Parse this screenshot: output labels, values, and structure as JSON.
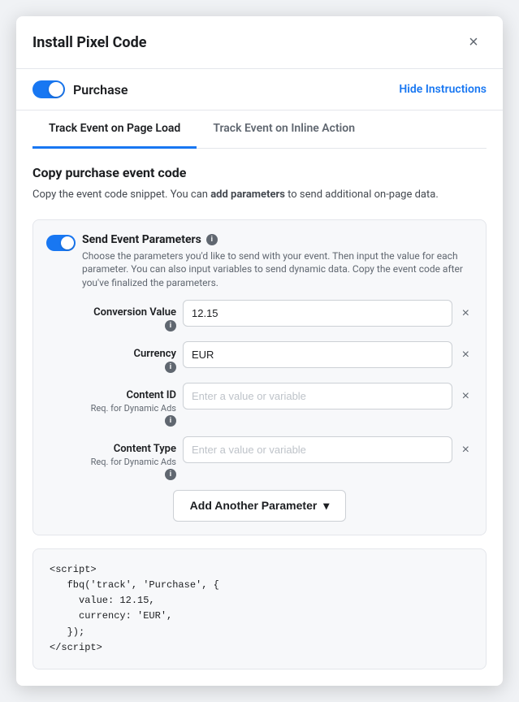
{
  "modal": {
    "title": "Install Pixel Code",
    "close_label": "×"
  },
  "header": {
    "toggle_label": "Purchase",
    "hide_instructions_label": "Hide Instructions"
  },
  "tabs": [
    {
      "label": "Track Event on Page Load",
      "active": true
    },
    {
      "label": "Track Event on Inline Action",
      "active": false
    }
  ],
  "section": {
    "title": "Copy purchase event code",
    "desc_plain": "Copy the event code snippet. You can ",
    "desc_bold": "add parameters",
    "desc_end": " to send additional on-page data."
  },
  "params": {
    "toggle_on": true,
    "title": "Send Event Parameters",
    "subtitle": "Choose the parameters you'd like to send with your event. Then input the value for each parameter. You can also input variables to send dynamic data. Copy the event code after you've finalized the parameters.",
    "rows": [
      {
        "label": "Conversion Value",
        "sublabel": "",
        "has_info": true,
        "value": "12.15",
        "placeholder": ""
      },
      {
        "label": "Currency",
        "sublabel": "",
        "has_info": true,
        "value": "EUR",
        "placeholder": ""
      },
      {
        "label": "Content ID",
        "sublabel": "Req. for Dynamic Ads",
        "has_info": true,
        "value": "",
        "placeholder": "Enter a value or variable"
      },
      {
        "label": "Content Type",
        "sublabel": "Req. for Dynamic Ads",
        "has_info": true,
        "value": "",
        "placeholder": "Enter a value or variable"
      }
    ],
    "add_button": "Add Another Parameter"
  },
  "code": {
    "content": "<script>\n   fbq('track', 'Purchase', {\n     value: 12.15,\n     currency: 'EUR',\n   });\n</script>"
  },
  "icons": {
    "info": "i",
    "close": "×",
    "dropdown": "▾"
  }
}
